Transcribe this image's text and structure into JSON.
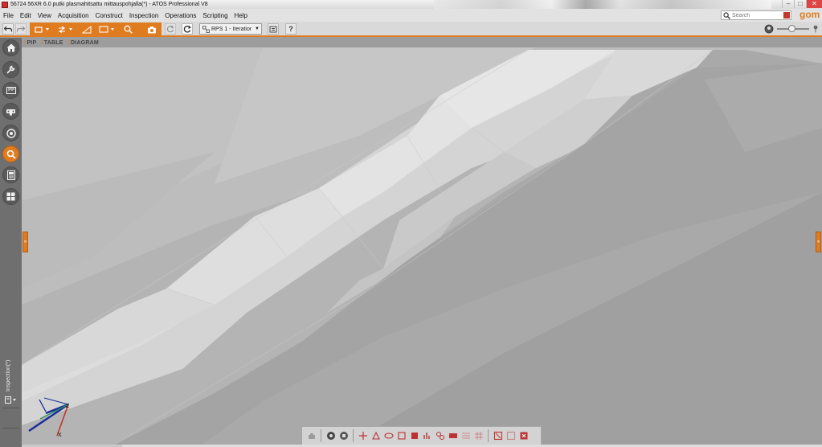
{
  "window": {
    "title": "56724 56XR 6.0 putki plasmahitsattu mittauspohjalla(*) - ATOS Professional V8",
    "minimize_glyph": "–",
    "restore_glyph": "□",
    "close_glyph": "✕"
  },
  "menu": {
    "items": [
      {
        "label": "File"
      },
      {
        "label": "Edit"
      },
      {
        "label": "View"
      },
      {
        "label": "Acquisition"
      },
      {
        "label": "Construct"
      },
      {
        "label": "Inspection"
      },
      {
        "label": "Operations"
      },
      {
        "label": "Scripting"
      },
      {
        "label": "Help"
      }
    ]
  },
  "search": {
    "placeholder": "Search"
  },
  "brand": {
    "logo_text": "gom"
  },
  "toolbar": {
    "alignment_label": "RPS 1 - Iteratior",
    "help_label": "?"
  },
  "tabs": [
    {
      "label": "PIP"
    },
    {
      "label": "TABLE"
    },
    {
      "label": "DIAGRAM"
    }
  ],
  "sidebar": {
    "buttons": [
      {
        "icon": "home-icon"
      },
      {
        "icon": "wrench-icon"
      },
      {
        "icon": "ruler-icon"
      },
      {
        "icon": "scanner-icon"
      },
      {
        "icon": "target-icon"
      },
      {
        "icon": "magnifier-icon",
        "active": true
      },
      {
        "icon": "report-icon"
      },
      {
        "icon": "grid-icon"
      }
    ],
    "vertical_label": "Inspection(*)"
  },
  "axes": {
    "x_label": "X",
    "z_label": "Z"
  },
  "colors": {
    "accent": "#e07c20",
    "sidebar": "#6f6f6f",
    "toolbar": "#d9d9d9",
    "viewport": "#b7b7b7"
  }
}
